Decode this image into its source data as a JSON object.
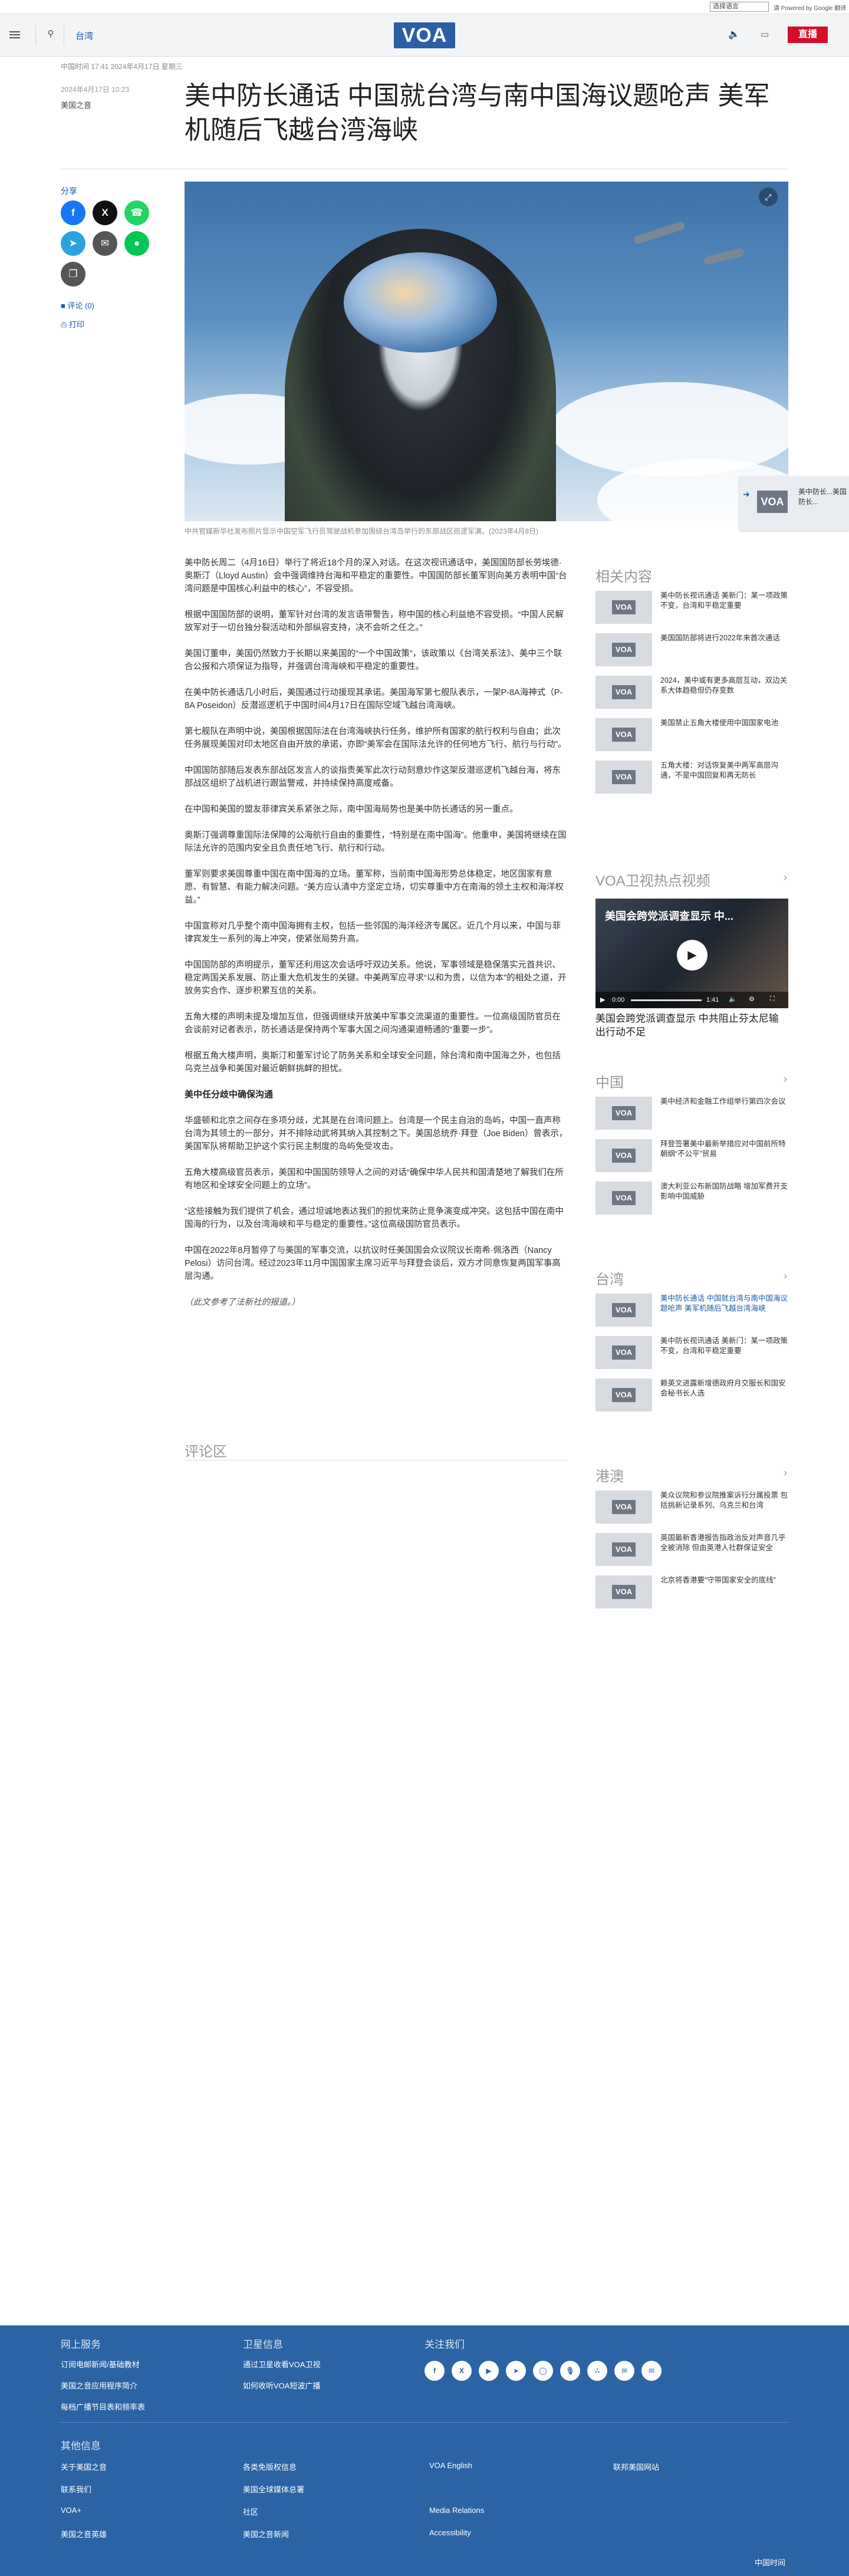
{
  "topbar": {
    "lang_select": "选择语言",
    "lang_note": "请 Powered by Google 翻译"
  },
  "nav": {
    "section": "台湾",
    "logo": "VOA",
    "live": "直播"
  },
  "article": {
    "date_line": "中国时间 17:41 2024年4月17日 星期三",
    "timestamp": "2024年4月17日 10:23",
    "author": "美国之音",
    "title": "美中防长通话 中国就台湾与南中国海议题呛声 美军机随后飞越台湾海峡",
    "caption": "中共官媒新华社发布照片显示中国空军飞行员驾驶战机参加围绕台湾岛举行的东部战区巡逻军演。(2023年4月8日)",
    "paragraphs": [
      "美中防长周二（4月16日）举行了将近18个月的深入对话。在这次视讯通话中，美国国防部长劳埃德·奥斯汀（Lloyd Austin）会中强调维持台海和平稳定的重要性。中国国防部长董军则向美方表明中国“台湾问题是中国核心利益中的核心”，不容受损。",
      "根据中国国防部的说明，董军针对台湾的发言语带警告，称中国的核心利益绝不容受损。“中国人民解放军对于一切台独分裂活动和外部纵容支持，决不会听之任之。”",
      "美国订董申，美国仍然致力于长期以来美国的“一个中国政策”，该政策以《台湾关系法》、美中三个联合公报和六项保证为指导，并强调台湾海峡和平稳定的重要性。",
      "在美中防长通话几小时后，美国通过行动援现其承诺。美国海军第七舰队表示，一架P-8A海神式（P-8A Poseidon）反潜巡逻机于中国时间4月17日在国际空域飞越台湾海峡。",
      "第七舰队在声明中说，美国根据国际法在台湾海峡执行任务，维护所有国家的航行权利与自由；此次任务展现美国对印太地区自由开放的承诺，亦即“美军会在国际法允许的任何地方飞行、航行与行动”。",
      "中国国防部随后发表东部战区发言人的谈指责美军此次行动刻意炒作这架反潜巡逻机飞越台海，将东部战区组织了战机进行跟监警戒，并持续保持高度戒备。",
      "在中国和美国的盟友菲律宾关系紧张之际，南中国海局势也是美中防长通话的另一重点。",
      "奥斯汀强调尊重国际法保障的公海航行自由的重要性，“特别是在南中国海”。他重申，美国将继续在国际法允许的范围内安全且负责任地飞行、航行和行动。",
      "董军则要求美国尊重中国在南中国海的立场。董军称，当前南中国海形势总体稳定，地区国家有意愿、有智慧、有能力解决问题。“美方应认清中方坚定立场，切实尊重中方在南海的领土主权和海洋权益。”",
      "中国宣称对几乎整个南中国海拥有主权，包括一些邻国的海洋经济专属区。近几个月以来，中国与菲律宾发生一系列的海上冲突，使紧张局势升高。",
      "中国国防部的声明提示，董军还利用这次会话呼吁双边关系。他说，军事领域是稳保落实元首共识、稳定两国关系发展、防止重大危机发生的关键。中美两军应寻求“以和为贵，以信为本”的相处之道，开放务实合作、逐步积累互信的关系。",
      "五角大楼的声明未提及增加互信，但强调继续开放美中军事交流渠道的重要性。一位高级国防官员在会谈前对记者表示，防长通话是保持两个军事大国之间沟通渠道畅通的“重要一步”。",
      "根据五角大楼声明，奥斯汀和董军讨论了防务关系和全球安全问题，除台湾和南中国海之外，也包括乌克兰战争和美国对最近朝鲜挑衅的担忧。",
      "华盛顿和北京之间存在多项分歧，尤其是在台湾问题上。台湾是一个民主自治的岛屿，中国一直声称台湾为其领土的一部分，并不排除动武将其纳入其控制之下。美国总统乔·拜登（Joe Biden）曾表示，美国军队将帮助卫护这个实行民主制度的岛屿免受攻击。",
      "五角大楼高级官员表示，美国和中国国防领导人之间的对话“确保中华人民共和国清楚地了解我们在所有地区和全球安全问题上的立场”。",
      "“这些接触为我们提供了机会，通过坦诚地表达我们的担忧来防止竞争演变成冲突。这包括中国在南中国海的行为，以及台湾海峡和平与稳定的重要性。”这位高级国防官员表示。",
      "中国在2022年8月暂停了与美国的军事交流，以抗议时任美国国会众议院议长南希·佩洛西（Nancy Pelosi）访问台湾。经过2023年11月中国国家主席习近平与拜登会谈后，双方才同意恢复两国军事高层沟通。"
    ],
    "subhead": "美中任分歧中确保沟通",
    "credit": "（此文参考了法新社的报道。）",
    "comments": "评论区"
  },
  "sidebar": {
    "share": "分享",
    "comments": "评论 (0)",
    "print": "打印"
  },
  "related": {
    "title": "相关内容",
    "items": [
      "美中防长视讯通话 美新门：某一项政策不变，台湾和平稳定重要",
      "美国国防部将进行2022年来首次通话",
      "2024，美中或有更多高层互动，双边关系大体趋稳但仍存变数",
      "美国禁止五角大楼使用中国国家电池",
      "五角大楼：对话恢复美中两军高层沟通，不是中国回复和再无防长"
    ]
  },
  "video": {
    "section": "VOA卫视热点视频",
    "overlay": "美国会跨党派调查显示 中...",
    "time": "0:00",
    "duration": "1:41",
    "caption": "美国会跨党派调查显示 中共阻止芬太尼输出行动不足"
  },
  "china": {
    "title": "中国",
    "items": [
      "美中经济和金融工作组举行第四次会议",
      "拜登签署美中最新举措应对中国前所特朝纲“不公平”贸易",
      "澳大利亚公布新国防战略 增加军费开支影响中国威胁"
    ]
  },
  "taiwan": {
    "title": "台湾",
    "items": [
      "美中防长通话 中国就台湾与南中国海议题呛声 美军机随后飞越台湾海峡",
      "美中防长视讯通话 美新门：某一项政策不变，台湾和平稳定重要",
      "赖英文进露新增德政府月交服长和国安会秘书长人选"
    ]
  },
  "hk": {
    "title": "港澳",
    "items": [
      "美众议院和参议院推案诉行分属投票 包括挑新记录系列、乌克兰和台湾",
      "英国最新香港报告指政治反对声音几乎全被消除 但由英港人社群保证安全",
      "北京将香港要“守带国家安全的底线”"
    ]
  },
  "floating": {
    "text": "美中防长...美国防长..."
  },
  "footer": {
    "col1_h": "网上服务",
    "col1": [
      "订阅电邮新闻/基础教材",
      "美国之音应用程序简介",
      "每档广播节目表和频率表"
    ],
    "col2_h": "卫星信息",
    "col2": [
      "通过卫星收看VOA卫视",
      "如何收听VOA短波广播"
    ],
    "col3_h": "关注我们",
    "icons": [
      "facebook",
      "X",
      "youtube",
      "telegram",
      "instagram",
      "podcast",
      "rss",
      "newsletter",
      "email"
    ],
    "other_h": "其他信息",
    "other": [
      [
        "关于美国之音",
        "各类免版权信息",
        "VOA English",
        "联邦美国网站"
      ],
      [
        "联系我们",
        "美国全球媒体总署",
        "",
        ""
      ],
      [
        "VOA+",
        "社区",
        "Media Relations",
        ""
      ],
      [
        "美国之音英雄",
        "美国之音新闻",
        "Accessibility",
        ""
      ]
    ],
    "bottom": "中国时间"
  },
  "colors": {
    "brand": "#2a5fa5",
    "live": "#d40e2a",
    "footer": "#2b63a5",
    "link": "#1a59a8"
  }
}
